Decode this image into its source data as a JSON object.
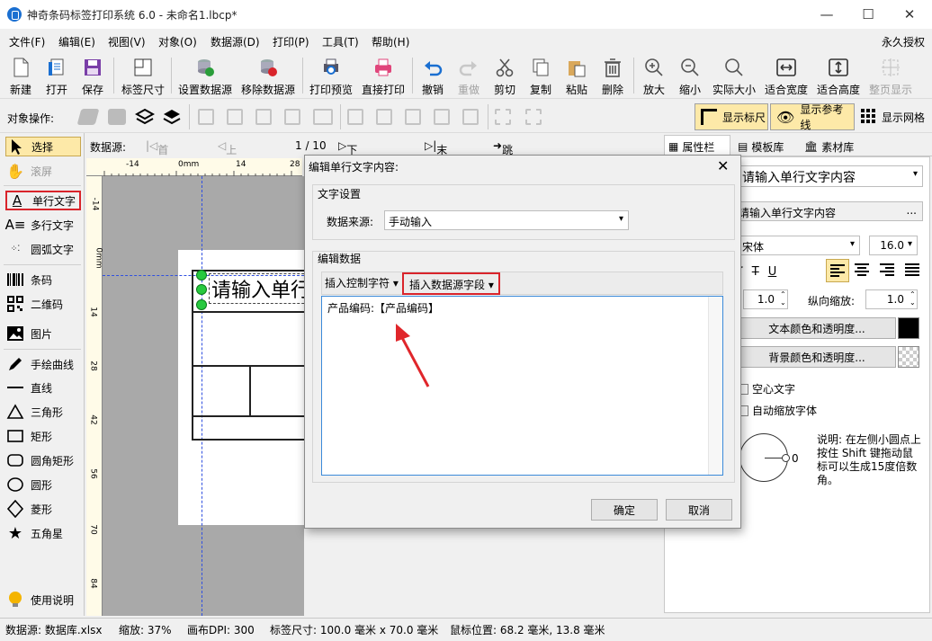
{
  "window": {
    "title": "神奇条码标签打印系统 6.0 - 未命名1.lbcp*"
  },
  "menu": [
    "文件(F)",
    "编辑(E)",
    "视图(V)",
    "对象(O)",
    "数据源(D)",
    "打印(P)",
    "工具(T)",
    "帮助(H)"
  ],
  "license": "永久授权",
  "toolbar": {
    "new": "新建",
    "open": "打开",
    "save": "保存",
    "label_size": "标签尺寸",
    "set_datasource": "设置数据源",
    "remove_datasource": "移除数据源",
    "print_preview": "打印预览",
    "direct_print": "直接打印",
    "undo": "撤销",
    "redo": "重做",
    "cut": "剪切",
    "copy": "复制",
    "paste": "粘贴",
    "delete": "删除",
    "zoom_in": "放大",
    "zoom_out": "缩小",
    "actual_size": "实际大小",
    "fit_width": "适合宽度",
    "fit_height": "适合高度",
    "page_display": "整页显示"
  },
  "toolbar2": {
    "object_ops": "对象操作:",
    "show_ruler": "显示标尺",
    "show_guides": "显示参考线",
    "show_grid": "显示网格"
  },
  "tools": {
    "select": "选择",
    "scroll": "滚屏",
    "single_text": "单行文字",
    "multi_text": "多行文字",
    "arc_text": "圆弧文字",
    "barcode": "条码",
    "qrcode": "二维码",
    "image": "图片",
    "freehand": "手绘曲线",
    "line": "直线",
    "triangle": "三角形",
    "rect": "矩形",
    "round_rect": "圆角矩形",
    "circle": "圆形",
    "diamond": "菱形",
    "star": "五角星",
    "help": "使用说明"
  },
  "nav": {
    "datasource": "数据源:",
    "first": "首条记录",
    "prev": "上一条记录",
    "page": "1 / 10",
    "next": "下一条记录",
    "last": "末条记录",
    "jump": "跳转到记录"
  },
  "ruler": {
    "top": [
      "-14",
      "0mm",
      "14",
      "28"
    ],
    "left": [
      "-14",
      "0mm",
      "14",
      "28",
      "42",
      "56",
      "70",
      "84"
    ]
  },
  "canvas": {
    "text": "请输入单行"
  },
  "dialog": {
    "title": "编辑单行文字内容:",
    "group1": "文字设置",
    "source_label": "数据来源:",
    "source_value": "手动输入",
    "group2": "编辑数据",
    "insert_control": "插入控制字符",
    "insert_field": "插入数据源字段",
    "content": "产品编码:【产品编码】",
    "ok": "确定",
    "cancel": "取消"
  },
  "right": {
    "tabs": [
      "属性栏",
      "模板库",
      "素材库"
    ],
    "content_select": "请输入单行文字内容",
    "content_input": "请输入单行文字内容",
    "more": "...",
    "font": "宋体",
    "font_size": "16.0",
    "hscale": "1.0",
    "vscale_label": "纵向缩放:",
    "vscale": "1.0",
    "text_color": "文本颜色和透明度...",
    "bg_color": "背景颜色和透明度...",
    "hollow": "空心文字",
    "autoscale": "自动缩放字体",
    "angle": "0",
    "hint": "说明: 在左侧小圆点上按住 Shift 键拖动鼠标可以生成15度倍数角。"
  },
  "status": {
    "datasource": "数据源: 数据库.xlsx",
    "zoom": "缩放: 37%",
    "dpi": "画布DPI: 300",
    "label_size": "标签尺寸: 100.0 毫米 x 70.0 毫米",
    "mouse": "鼠标位置: 68.2 毫米, 13.8 毫米"
  },
  "colors": {
    "highlight": "#d9242b",
    "accent": "#1a6fd1",
    "toggle_bg": "#fde9a8"
  }
}
